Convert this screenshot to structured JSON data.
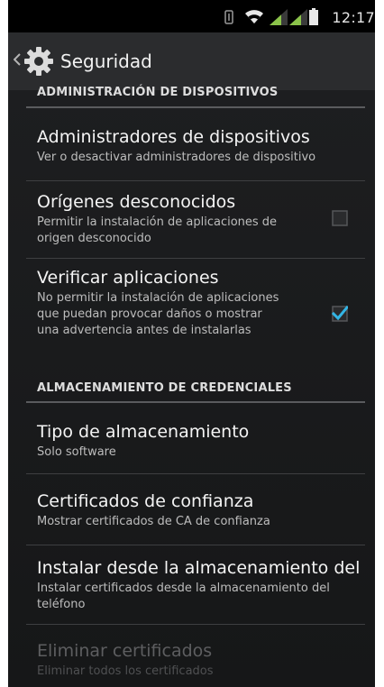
{
  "status_bar": {
    "time": "12:17",
    "icons": [
      "vibrate-icon",
      "wifi-icon",
      "signal-1-icon",
      "signal-2-icon",
      "battery-icon"
    ],
    "signal_color": "#8bc34a",
    "battery_color": "#ffffff"
  },
  "action_bar": {
    "title": "Seguridad",
    "icon": "gear-icon",
    "back_icon": "chevron-left-icon"
  },
  "sections": {
    "device_admin": {
      "header": "ADMINISTRACIÓN DE DISPOSITIVOS",
      "items": [
        {
          "title": "Administradores de dispositivos",
          "summary": "Ver o desactivar administradores de dispositivo"
        },
        {
          "title": "Orígenes desconocidos",
          "summary": "Permitir la instalación de aplicaciones de origen desconocido",
          "checked": false
        },
        {
          "title": "Verificar aplicaciones",
          "summary": "No permitir la instalación de aplicaciones que puedan provocar daños o mostrar una advertencia antes de instalarlas",
          "checked": true
        }
      ]
    },
    "credentials": {
      "header": "ALMACENAMIENTO DE CREDENCIALES",
      "items": [
        {
          "title": "Tipo de almacenamiento",
          "summary": "Solo software"
        },
        {
          "title": "Certificados de confianza",
          "summary": "Mostrar certificados de CA de confianza"
        },
        {
          "title": "Instalar desde la almacenamiento del",
          "summary": "Instalar certificados desde la almacenamiento del teléfono"
        },
        {
          "title": "Eliminar certificados",
          "summary": "Eliminar todos los certificados",
          "enabled": false
        }
      ]
    }
  },
  "colors": {
    "background": "#1b1c1e",
    "accent": "#33b5e5",
    "text": "#f4f4f4",
    "summary_text": "#bdbdbd"
  }
}
